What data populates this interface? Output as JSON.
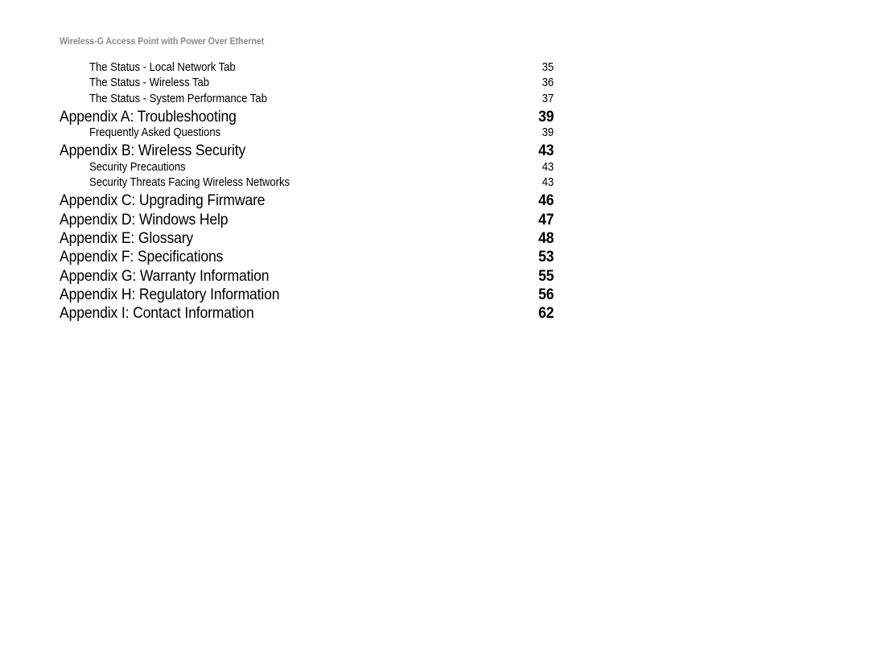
{
  "header": {
    "running_title": "Wireless-G Access Point with Power Over Ethernet"
  },
  "toc": {
    "entries": [
      {
        "level": 2,
        "title": "The Status - Local Network Tab",
        "page": "35"
      },
      {
        "level": 2,
        "title": "The Status - Wireless Tab",
        "page": "36"
      },
      {
        "level": 2,
        "title": "The Status - System Performance Tab",
        "page": "37"
      },
      {
        "level": 1,
        "title": "Appendix A: Troubleshooting",
        "page": "39"
      },
      {
        "level": 2,
        "title": "Frequently Asked Questions",
        "page": "39"
      },
      {
        "level": 1,
        "title": "Appendix B: Wireless Security",
        "page": "43"
      },
      {
        "level": 2,
        "title": "Security Precautions",
        "page": "43"
      },
      {
        "level": 2,
        "title": "Security Threats Facing Wireless Networks",
        "page": "43"
      },
      {
        "level": 1,
        "title": "Appendix C: Upgrading Firmware",
        "page": "46"
      },
      {
        "level": 1,
        "title": "Appendix D: Windows Help",
        "page": "47"
      },
      {
        "level": 1,
        "title": "Appendix E: Glossary",
        "page": "48"
      },
      {
        "level": 1,
        "title": "Appendix F: Specifications",
        "page": "53"
      },
      {
        "level": 1,
        "title": "Appendix G: Warranty Information",
        "page": "55"
      },
      {
        "level": 1,
        "title": "Appendix H: Regulatory Information",
        "page": "56"
      },
      {
        "level": 1,
        "title": "Appendix I: Contact Information",
        "page": "62"
      }
    ]
  },
  "colors": {
    "page_background": "#ffffff",
    "body_text": "#000000",
    "header_text": "#8c8c8c"
  }
}
